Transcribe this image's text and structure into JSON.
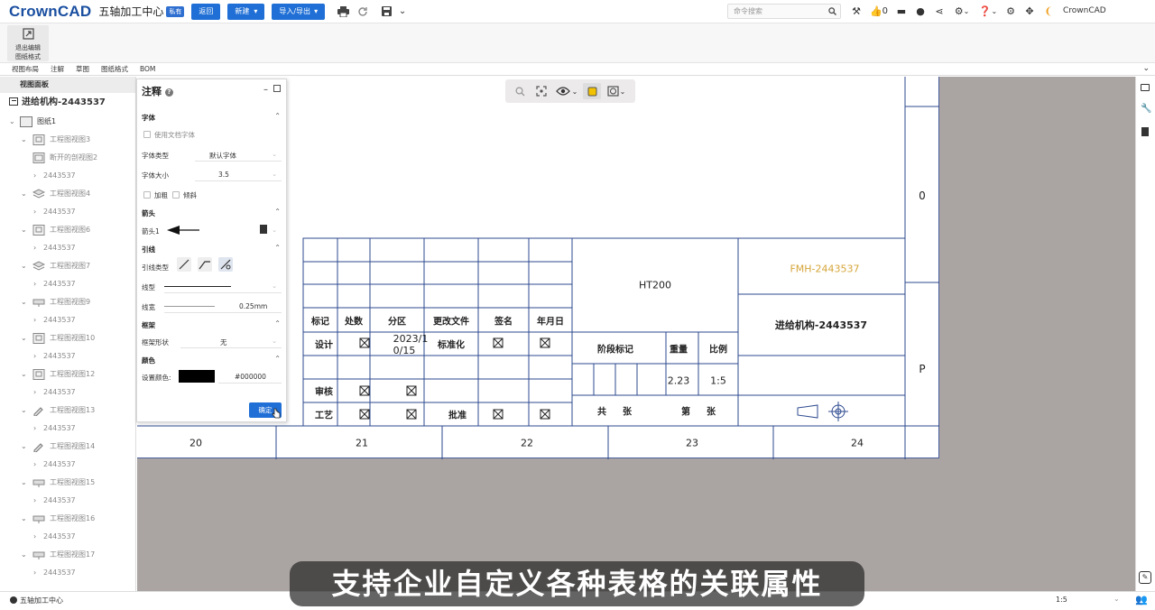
{
  "app": {
    "logo": "CrownCAD",
    "doc_title": "五轴加工中心",
    "badge": "私有",
    "back_btn": "返回",
    "new_btn": "新建",
    "import_export_btn": "导入/导出",
    "search_placeholder": "命令搜索",
    "like_count": "0",
    "user": "CrownCAD"
  },
  "ribbon": {
    "exit_label_1": "退出编辑",
    "exit_label_2": "图纸格式"
  },
  "tabs": [
    "视图布局",
    "注解",
    "草图",
    "图纸格式",
    "BOM"
  ],
  "left_panel": {
    "header": "视图面板",
    "root": "进给机构-2443537",
    "sheet": "图纸1",
    "items": [
      {
        "label": "工程图视图3",
        "level": 1,
        "icon": "page"
      },
      {
        "label": "断开的剖视图2",
        "level": 2,
        "icon": "section"
      },
      {
        "label": "2443537",
        "level": 2,
        "icon": "none"
      },
      {
        "label": "工程图视图4",
        "level": 1,
        "icon": "iso"
      },
      {
        "label": "2443537",
        "level": 2,
        "icon": "none"
      },
      {
        "label": "工程图视图6",
        "level": 1,
        "icon": "page"
      },
      {
        "label": "2443537",
        "level": 2,
        "icon": "none"
      },
      {
        "label": "工程图视图7",
        "level": 1,
        "icon": "iso"
      },
      {
        "label": "2443537",
        "level": 2,
        "icon": "none"
      },
      {
        "label": "工程图视图9",
        "level": 1,
        "icon": "flat"
      },
      {
        "label": "2443537",
        "level": 2,
        "icon": "none"
      },
      {
        "label": "工程图视图10",
        "level": 1,
        "icon": "page"
      },
      {
        "label": "2443537",
        "level": 2,
        "icon": "none"
      },
      {
        "label": "工程图视图12",
        "level": 1,
        "icon": "page"
      },
      {
        "label": "2443537",
        "level": 2,
        "icon": "none"
      },
      {
        "label": "工程图视图13",
        "level": 1,
        "icon": "pen"
      },
      {
        "label": "2443537",
        "level": 2,
        "icon": "none"
      },
      {
        "label": "工程图视图14",
        "level": 1,
        "icon": "pen"
      },
      {
        "label": "2443537",
        "level": 2,
        "icon": "none"
      },
      {
        "label": "工程图视图15",
        "level": 1,
        "icon": "flat"
      },
      {
        "label": "2443537",
        "level": 2,
        "icon": "none"
      },
      {
        "label": "工程图视图16",
        "level": 1,
        "icon": "flat"
      },
      {
        "label": "2443537",
        "level": 2,
        "icon": "none"
      },
      {
        "label": "工程图视图17",
        "level": 1,
        "icon": "flat"
      },
      {
        "label": "2443537",
        "level": 2,
        "icon": "none"
      }
    ]
  },
  "annotation_panel": {
    "title": "注释",
    "font_section": "字体",
    "use_doc_font": "使用文档字体",
    "font_type_label": "字体类型",
    "font_type_value": "默认字体",
    "font_size_label": "字体大小",
    "font_size_value": "3.5",
    "bold_label": "加粗",
    "italic_label": "倾斜",
    "arrow_section": "箭头",
    "arrow_label": "箭头1",
    "leader_section": "引线",
    "leader_type_label": "引线类型",
    "line_type_label": "线型",
    "line_width_label": "线宽",
    "line_width_value": "0.25mm",
    "frame_section": "框架",
    "frame_shape_label": "框架形状",
    "frame_shape_value": "无",
    "color_section": "颜色",
    "set_color_label": "设置颜色:",
    "color_value": "#000000",
    "ok_btn": "确定"
  },
  "title_block": {
    "material": "HT200",
    "drawing_no": "FMH-2443537",
    "part_name": "进给机构-2443537",
    "h_mark": "标记",
    "h_count": "处数",
    "h_zone": "分区",
    "h_change": "更改文件",
    "h_sign": "签名",
    "h_date": "年月日",
    "design": "设计",
    "date_value": "2023/1\n0/15",
    "standard": "标准化",
    "stage_mark": "阶段标记",
    "weight": "重量",
    "scale": "比例",
    "weight_value": "2.23",
    "scale_value": "1:5",
    "review": "审核",
    "process": "工艺",
    "approve": "批准",
    "total": "共",
    "sheets": "张",
    "page_no": "第",
    "page_sheets": "张",
    "zone_o": "0",
    "zone_p": "P",
    "columns": [
      "20",
      "21",
      "22",
      "23",
      "24"
    ]
  },
  "status": {
    "project": "五轴加工中心",
    "scale": "1:5"
  },
  "subtitle": "支持企业自定义各种表格的关联属性"
}
